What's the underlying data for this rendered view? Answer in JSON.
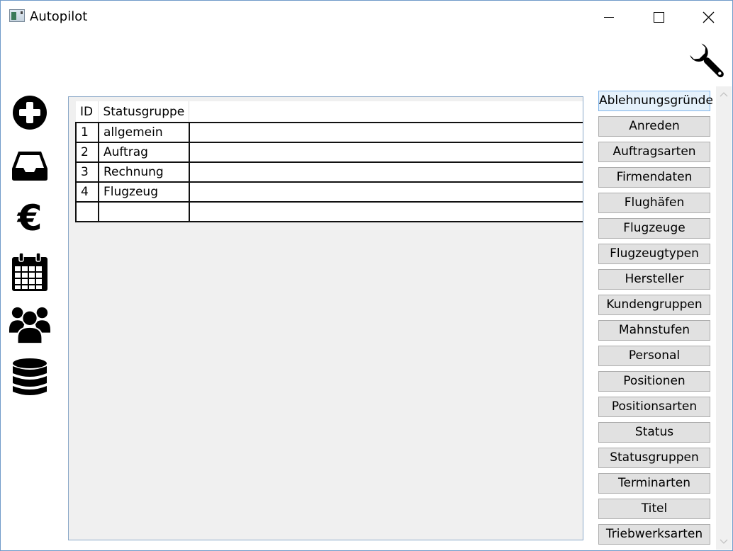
{
  "window": {
    "title": "Autopilot"
  },
  "sidebar": {
    "items": [
      {
        "icon": "plus-circle-icon"
      },
      {
        "icon": "inbox-icon"
      },
      {
        "icon": "euro-icon",
        "glyph": "€"
      },
      {
        "icon": "calendar-icon"
      },
      {
        "icon": "users-icon"
      },
      {
        "icon": "database-icon"
      }
    ]
  },
  "toolbar": {
    "settings_icon": "wrench-icon"
  },
  "grid": {
    "columns": [
      "ID",
      "Statusgruppe"
    ],
    "rows": [
      {
        "id": "1",
        "name": "allgemein"
      },
      {
        "id": "2",
        "name": "Auftrag"
      },
      {
        "id": "3",
        "name": "Rechnung"
      },
      {
        "id": "4",
        "name": "Flugzeug"
      },
      {
        "id": "",
        "name": ""
      }
    ]
  },
  "buttons": [
    "Ablehnungsgründe",
    "Anreden",
    "Auftragsarten",
    "Firmendaten",
    "Flughäfen",
    "Flugzeuge",
    "Flugzeugtypen",
    "Hersteller",
    "Kundengruppen",
    "Mahnstufen",
    "Personal",
    "Positionen",
    "Positionsarten",
    "Status",
    "Statusgruppen",
    "Terminarten",
    "Titel",
    "Triebwerksarten"
  ],
  "colors": {
    "window_border": "#6f9ac9",
    "button_bg": "#e1e1e1",
    "button_border": "#adadad",
    "grid_bg": "#f0f0f0"
  }
}
